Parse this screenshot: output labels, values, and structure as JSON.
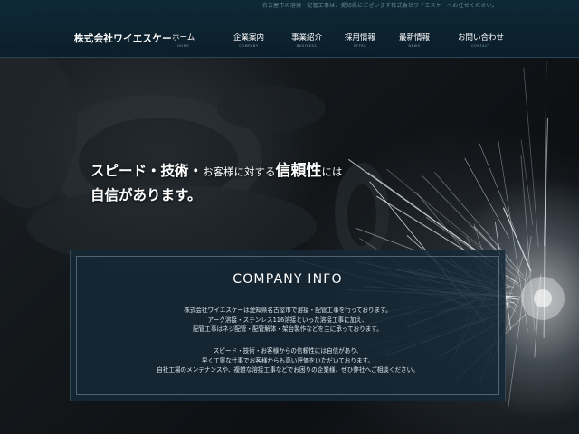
{
  "header": {
    "tagline": "名古屋市の溶接・配管工事は、愛知県にございます株式会社ワイエスケーへお任せください。",
    "logo": "株式会社ワイエスケー",
    "nav": [
      {
        "label": "ホーム",
        "sub": "HOME"
      },
      {
        "label": "企業案内",
        "sub": "COMPANY"
      },
      {
        "label": "事業紹介",
        "sub": "BUSINESS"
      },
      {
        "label": "採用情報",
        "sub": "OFFER"
      },
      {
        "label": "最新情報",
        "sub": "NEWS"
      },
      {
        "label": "お問い合わせ",
        "sub": "CONTACT"
      }
    ]
  },
  "hero": {
    "part1": "スピード・技術・",
    "part2": "お客様に対する",
    "part3": "信頼性",
    "part4": "には",
    "line2": "自信があります。"
  },
  "company_info": {
    "title": "COMPANY INFO",
    "para1": [
      "株式会社ワイエスケーは愛知県名古屋市で溶接・配管工事を行っております。",
      "アーク溶接・ステンレス116溶接といった溶接工事に加え、",
      "配管工事はネジ配管・配管解体・架台製作などを主に承っております。"
    ],
    "para2": [
      "スピード・技術・お客様からの信頼性には自信があり、",
      "早く丁寧な仕事でお客様からも高い評価をいただいております。",
      "自社工場のメンテナンスや、複雑な溶接工事などでお困りの企業様、ぜひ弊社へご相談ください。"
    ]
  }
}
